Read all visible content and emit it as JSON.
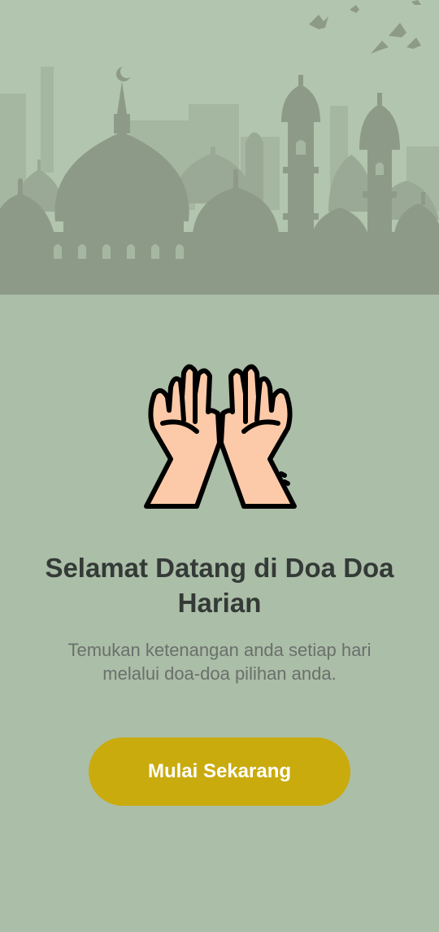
{
  "welcome": {
    "title": "Selamat Datang di Doa Doa Harian",
    "subtitle": "Temukan ketenangan anda setiap hari melalui doa-doa pilihan anda.",
    "start_button_label": "Mulai Sekarang"
  },
  "icons": {
    "header": "mosque-skyline-illustration",
    "main": "praying-hands-icon"
  },
  "colors": {
    "background": "#abbea7",
    "header_background": "#b2c5ae",
    "silhouette": "#8e9a88",
    "title": "#343a37",
    "subtitle": "#6a706c",
    "button": "#c9ab0e",
    "button_text": "#ffffff",
    "hand_skin": "#fccaa8"
  }
}
